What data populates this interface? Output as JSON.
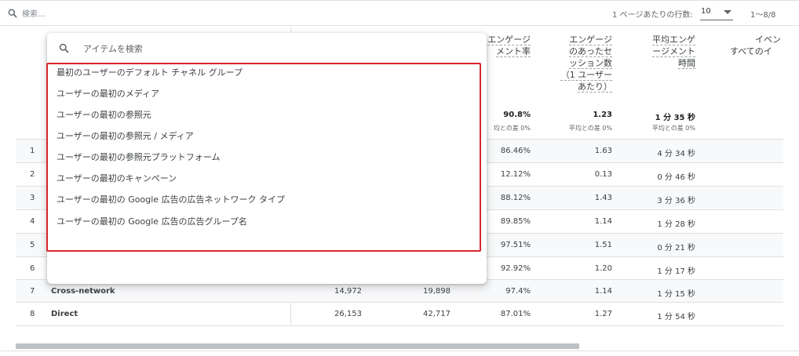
{
  "toolbar": {
    "search_placeholder": "検索...",
    "rows_label": "1 ページあたりの行数:",
    "rows_value": "10",
    "page_range": "1～8/8"
  },
  "columns": [
    {
      "lines": [
        "エンゲージ",
        "メント率"
      ]
    },
    {
      "lines": [
        "エンゲージ",
        "のあったセ",
        "ッション数",
        "（1 ユーザー",
        "あたり）"
      ]
    },
    {
      "lines": [
        "平均エンゲ",
        "ージメント",
        "時間"
      ]
    },
    {
      "lines": [
        "イベン",
        "すべてのイ"
      ]
    }
  ],
  "totals": [
    {
      "value": "90.8%",
      "sub": "均との差 0%"
    },
    {
      "value": "1.23",
      "sub": "平均との差 0%"
    },
    {
      "value": "1 分 35 秒",
      "sub": "平均との差 0%"
    }
  ],
  "rows": [
    {
      "idx": "1",
      "name": "",
      "c1": "",
      "c2": "",
      "rate": "86.46%",
      "per_user": "1.63",
      "time": "4 分 34 秒"
    },
    {
      "idx": "2",
      "name": "",
      "c1": "",
      "c2": "",
      "rate": "12.12%",
      "per_user": "0.13",
      "time": "0 分 46 秒"
    },
    {
      "idx": "3",
      "name": "",
      "c1": "",
      "c2": "",
      "rate": "88.12%",
      "per_user": "1.43",
      "time": "3 分 36 秒"
    },
    {
      "idx": "4",
      "name": "",
      "c1": "",
      "c2": "",
      "rate": "89.85%",
      "per_user": "1.14",
      "time": "1 分 28 秒"
    },
    {
      "idx": "5",
      "name": "",
      "c1": "",
      "c2": "",
      "rate": "97.51%",
      "per_user": "1.51",
      "time": "0 分 21 秒"
    },
    {
      "idx": "6",
      "name": "",
      "c1": "",
      "c2": "",
      "rate": "92.92%",
      "per_user": "1.20",
      "time": "1 分 17 秒"
    },
    {
      "idx": "7",
      "name": "Cross-network",
      "c1": "14,972",
      "c2": "19,898",
      "rate": "97.4%",
      "per_user": "1.14",
      "time": "1 分 15 秒"
    },
    {
      "idx": "8",
      "name": "Direct",
      "c1": "26,153",
      "c2": "42,717",
      "rate": "87.01%",
      "per_user": "1.27",
      "time": "1 分 54 秒"
    }
  ],
  "popup": {
    "search_placeholder": "アイテムを検索",
    "options": [
      "最初のユーザーのデフォルト チャネル グループ",
      "ユーザーの最初のメディア",
      "ユーザーの最初の参照元",
      "ユーザーの最初の参照元 / メディア",
      "ユーザーの最初の参照元プラットフォーム",
      "ユーザーの最初のキャンペーン",
      "ユーザーの最初の Google 広告の広告ネットワーク タイプ",
      "ユーザーの最初の Google 広告の広告グループ名"
    ],
    "highlight_color": "#d9262c"
  }
}
